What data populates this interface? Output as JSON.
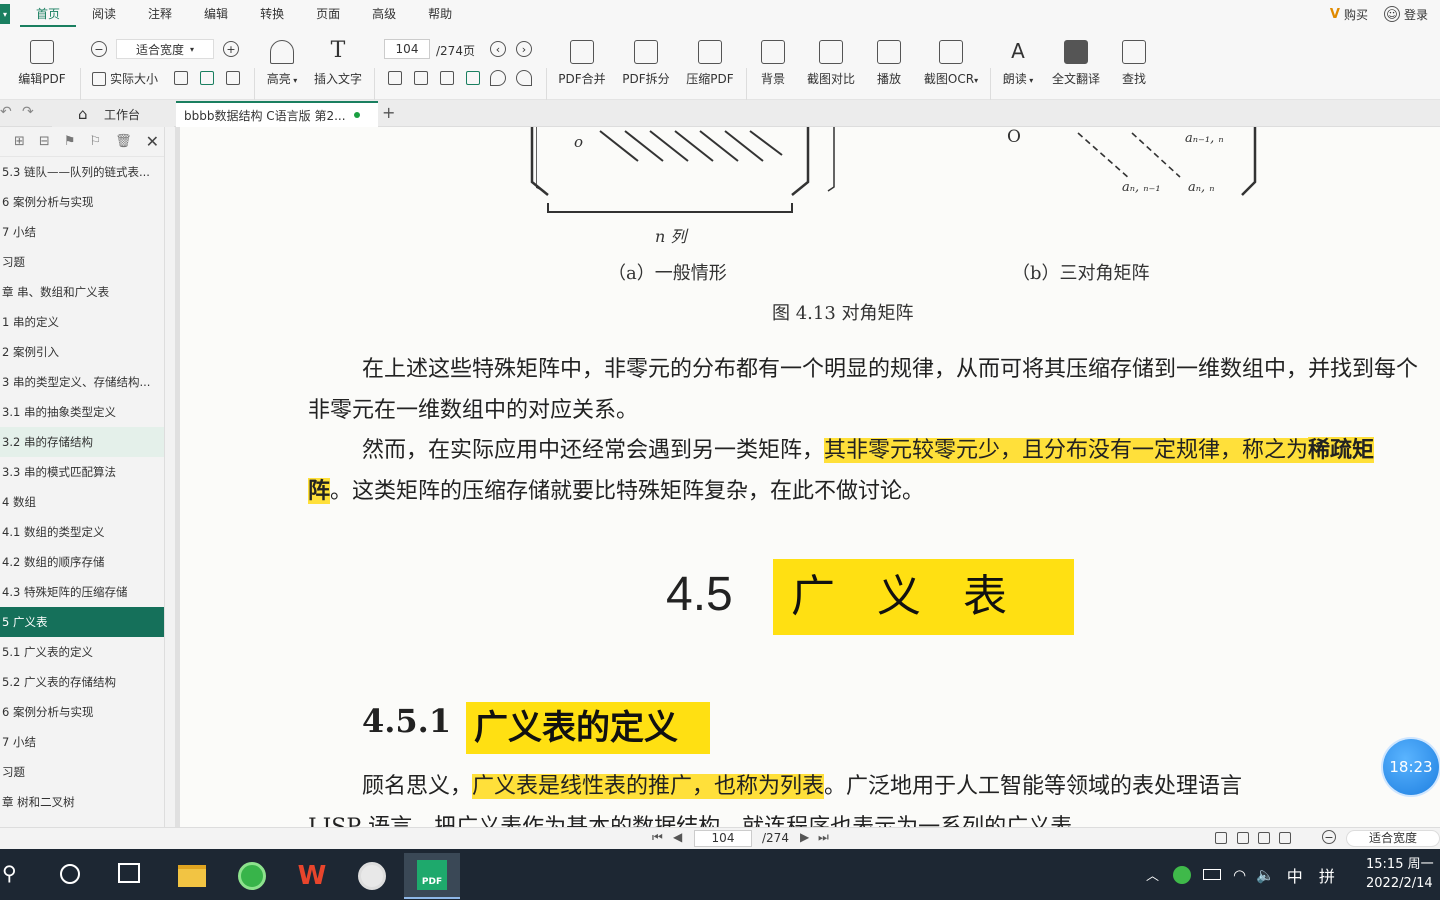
{
  "menubar": {
    "items": [
      "首页",
      "阅读",
      "注释",
      "编辑",
      "转换",
      "页面",
      "高级",
      "帮助"
    ],
    "buy": "购买",
    "login": "登录"
  },
  "toolbar": {
    "edit_pdf": "编辑PDF",
    "zoom_value": "适合宽度",
    "actual_size": "实际大小",
    "highlight": "高亮",
    "insert_text": "插入文字",
    "page_current": "104",
    "page_total": "/274页",
    "pdf_merge": "PDF合并",
    "pdf_split": "PDF拆分",
    "compress_pdf": "压缩PDF",
    "background": "背景",
    "screenshot_compare": "截图对比",
    "play": "播放",
    "screenshot_ocr": "截图OCR",
    "read_aloud": "朗读",
    "full_translate": "全文翻译",
    "find": "查找"
  },
  "tabs": {
    "home": "工作台",
    "doc": "bbbb数据结构  C语言版  第2..."
  },
  "toc": [
    "5.3  链队——队列的链式表...",
    "6  案例分析与实现",
    "7  小结",
    "习题",
    "章  串、数组和广义表",
    "1  串的定义",
    "2  案例引入",
    "3  串的类型定义、存储结构...",
    "3.1  串的抽象类型定义",
    "3.2  串的存储结构",
    "3.3  串的模式匹配算法",
    "4  数组",
    "4.1  数组的类型定义",
    "4.2  数组的顺序存储",
    "4.3  特殊矩阵的压缩存储",
    "5  广义表",
    "5.1  广义表的定义",
    "5.2  广义表的存储结构",
    "6  案例分析与实现",
    "7  小结",
    "习题",
    "章  树和二叉树"
  ],
  "document": {
    "fig_a_zero": "o",
    "fig_b_zero": "O",
    "fig_ncol": "n 列",
    "fig_b_sub1": "aₙ₋₁, ₙ",
    "fig_b_sub2": "aₙ, ₙ₋₁",
    "fig_b_sub3": "aₙ, ₙ",
    "caption_a": "（a）一般情形",
    "caption_b": "（b）三对角矩阵",
    "figure_caption": "图 4.13    对角矩阵",
    "para1": "在上述这些特殊矩阵中，非零元的分布都有一个明显的规律，从而可将其压缩存储到一维数组中，并找到每个非零元在一维数组中的对应关系。",
    "para2_pre": "然而，在实际应用中还经常会遇到另一类矩阵，",
    "para2_hl": "其非零元较零元少，且分布没有一定规律，称之为",
    "para2_bold": "稀疏矩阵",
    "para2_post": "。这类矩阵的压缩存储就要比特殊矩阵复杂，在此不做讨论。",
    "section_num": "4.5",
    "section_title": "广义表",
    "subsection_num": "4.5.1",
    "subsection_title": "广义表的定义",
    "para3_pre": "顾名思义，",
    "para3_hl": "广义表是线性表的推广，也称为列表",
    "para3_post": "。广泛地用于人工智能等领域的表处理语言",
    "para4": "LISP 语言，把广义表作为基本的数据结构，就连程序也表示为一系列的广义表。"
  },
  "timer": "18:23",
  "statusbar": {
    "page_current": "104",
    "page_total": "/274",
    "zoom": "适合宽度"
  },
  "taskbar": {
    "ime": "中",
    "ime2": "拼",
    "time": "15:15 周一",
    "date": "2022/2/14"
  }
}
